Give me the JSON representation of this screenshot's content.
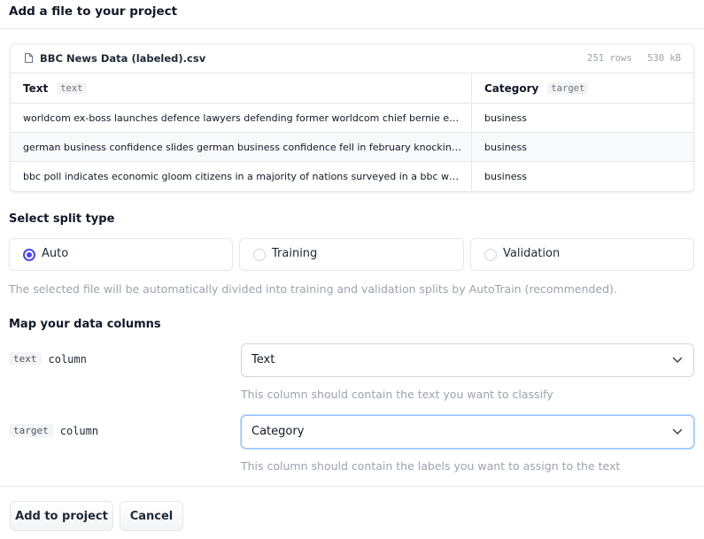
{
  "header": {
    "title": "Add a file to your project"
  },
  "file": {
    "name": "BBC News Data (labeled).csv",
    "rows": "251 rows",
    "size": "530 kB",
    "icon": "file-icon",
    "columns": [
      {
        "label": "Text",
        "badge": "text"
      },
      {
        "label": "Category",
        "badge": "target"
      }
    ],
    "rows_data": [
      {
        "text": "worldcom ex-boss launches defence lawyers defending former worldcom chief bernie ebbers against a battery of fraud charges",
        "category": "business"
      },
      {
        "text": "german business confidence slides german business confidence fell in february knocking hopes of a speedy recovery",
        "category": "business"
      },
      {
        "text": "bbc poll indicates economic gloom citizens in a majority of nations surveyed in a bbc world service poll",
        "category": "business"
      }
    ]
  },
  "split": {
    "title": "Select split type",
    "options": [
      "Auto",
      "Training",
      "Validation"
    ],
    "selected": "Auto",
    "helper": "The selected file will be automatically divided into training and validation splits by AutoTrain (recommended)."
  },
  "mapping": {
    "title": "Map your data columns",
    "rows": [
      {
        "badge": "text",
        "word": "column",
        "value": "Text",
        "helper": "This column should contain the text you want to classify"
      },
      {
        "badge": "target",
        "word": "column",
        "value": "Category",
        "helper": "This column should contain the labels you want to assign to the text"
      }
    ]
  },
  "buttons": {
    "add": "Add to project",
    "cancel": "Cancel"
  },
  "colors": {
    "accent": "#4f46e5",
    "border": "#e5e7eb",
    "muted": "#9ca3af",
    "focus": "#93c5fd"
  }
}
